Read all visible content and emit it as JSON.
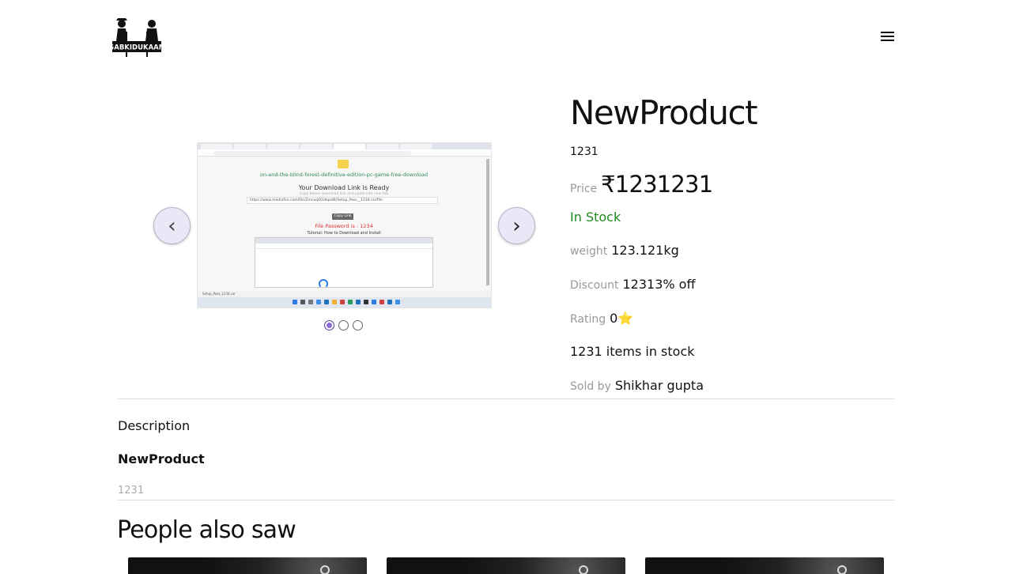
{
  "header": {
    "brand_name": "SABKIDUKAAN",
    "logo_icon": "people-carrying-banner-logo",
    "menu_icon": "hamburger-menu-icon"
  },
  "carousel": {
    "prev_glyph": "‹",
    "next_glyph": "›",
    "slide_count": 3,
    "active_index": 0,
    "slide": {
      "page_title": "on-and-the-blind-forest-definitive-edition-pc-game-free-download",
      "heading": "Your Download Link is Ready",
      "subheading": "Copy below download link and paste into new tab",
      "link_value": "https://www.mediafire.com/file/2mnxq60idepx8t/Setup_Pass__1234.rar/file",
      "copy_button": "Copy Link",
      "password_text": "File Password is : 1234",
      "tutorial_text": "Tutorial: How to Download and Install",
      "status_file": "Setup_Pass_1234.rar"
    }
  },
  "product": {
    "title": "NewProduct",
    "short_description": "1231",
    "price_label": "Price",
    "price": "₹1231231",
    "stock_status": "In Stock",
    "weight_label": "weight",
    "weight": "123.121kg",
    "discount_label": "Discount",
    "discount": "12313% off",
    "rating_label": "Rating",
    "rating": "0",
    "rating_icon": "star-icon",
    "items_in_stock": "1231 items in stock",
    "seller_label": "Sold by",
    "seller": "Shikhar gupta"
  },
  "description": {
    "label": "Description",
    "title": "NewProduct",
    "body": "1231"
  },
  "related": {
    "heading": "People also saw",
    "cards": [
      {
        "image": "dark-animal-photo"
      },
      {
        "image": "dark-animal-photo"
      },
      {
        "image": "dark-animal-photo"
      }
    ]
  },
  "colors": {
    "in_stock": "#1d8a1d",
    "active_dot": "#8b6cd4",
    "nav_button_bg": "#ece7f6",
    "star": "#f3c33a"
  }
}
